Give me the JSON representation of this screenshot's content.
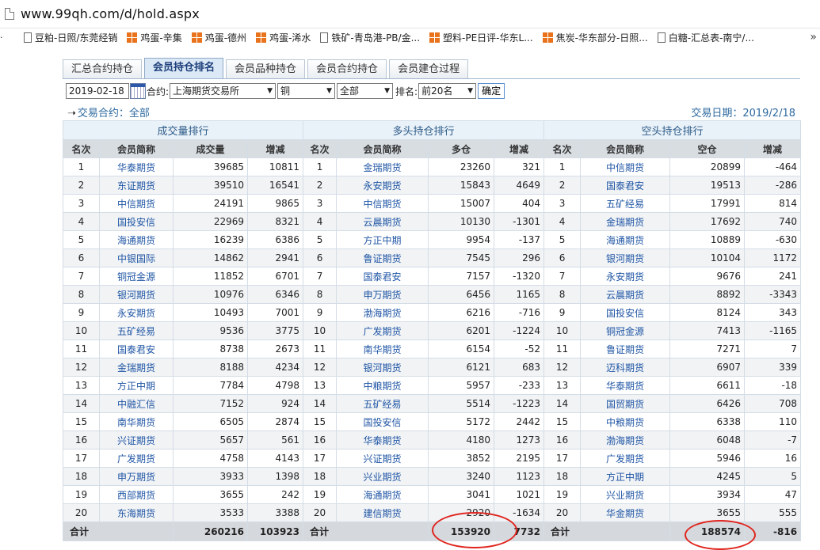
{
  "browser": {
    "url": "www.99qh.com/d/hold.aspx",
    "bookmarks": [
      {
        "icon": "doc",
        "label": "豆粕-日照/东莞经销"
      },
      {
        "icon": "grid",
        "label": "鸡蛋-辛集"
      },
      {
        "icon": "grid",
        "label": "鸡蛋-德州"
      },
      {
        "icon": "grid",
        "label": "鸡蛋-浠水"
      },
      {
        "icon": "doc",
        "label": "铁矿-青岛港-PB/金..."
      },
      {
        "icon": "doc",
        "label": "塑料-PE日评-华东L..."
      },
      {
        "icon": "grid",
        "label": "焦炭-华东部分-日照..."
      },
      {
        "icon": "doc",
        "label": "白糖-汇总表-南宁/..."
      }
    ]
  },
  "tabs": [
    "汇总合约持仓",
    "会员持仓排名",
    "会员品种持仓",
    "会员合约持仓",
    "会员建仓过程"
  ],
  "active_tab": 1,
  "filters": {
    "date": "2019-02-18",
    "contract_label": "合约:",
    "exchange": "上海期货交易所",
    "variety": "铜",
    "contract": "全部",
    "rank_label": "排名:",
    "rank": "前20名",
    "confirm": "确定"
  },
  "info": {
    "contract_text": "交易合约：全部",
    "date_text": "交易日期：2019/2/18"
  },
  "table": {
    "groups": [
      "成交量排行",
      "多头持仓排行",
      "空头持仓排行"
    ],
    "headers": [
      "名次",
      "会员简称",
      "成交量",
      "增减",
      "名次",
      "会员简称",
      "多仓",
      "增减",
      "名次",
      "会员简称",
      "空仓",
      "增减"
    ],
    "rows": [
      [
        "1",
        "华泰期货",
        "39685",
        "10811",
        "1",
        "金瑞期货",
        "23260",
        "321",
        "1",
        "中信期货",
        "20899",
        "-464"
      ],
      [
        "2",
        "东证期货",
        "39510",
        "16541",
        "2",
        "永安期货",
        "15843",
        "4649",
        "2",
        "国泰君安",
        "19513",
        "-286"
      ],
      [
        "3",
        "中信期货",
        "24191",
        "9865",
        "3",
        "中信期货",
        "15007",
        "404",
        "3",
        "五矿经易",
        "17991",
        "814"
      ],
      [
        "4",
        "国投安信",
        "22969",
        "8321",
        "4",
        "云晨期货",
        "10130",
        "-1301",
        "4",
        "金瑞期货",
        "17692",
        "740"
      ],
      [
        "5",
        "海通期货",
        "16239",
        "6386",
        "5",
        "方正中期",
        "9954",
        "-137",
        "5",
        "海通期货",
        "10889",
        "-630"
      ],
      [
        "6",
        "中银国际",
        "14862",
        "2941",
        "6",
        "鲁证期货",
        "7545",
        "296",
        "6",
        "银河期货",
        "10104",
        "1172"
      ],
      [
        "7",
        "铜冠金源",
        "11852",
        "6701",
        "7",
        "国泰君安",
        "7157",
        "-1320",
        "7",
        "永安期货",
        "9676",
        "241"
      ],
      [
        "8",
        "银河期货",
        "10976",
        "6346",
        "8",
        "申万期货",
        "6456",
        "1165",
        "8",
        "云晨期货",
        "8892",
        "-3343"
      ],
      [
        "9",
        "永安期货",
        "10493",
        "7001",
        "9",
        "渤海期货",
        "6216",
        "-716",
        "9",
        "国投安信",
        "8124",
        "343"
      ],
      [
        "10",
        "五矿经易",
        "9536",
        "3775",
        "10",
        "广发期货",
        "6201",
        "-1224",
        "10",
        "铜冠金源",
        "7413",
        "-1165"
      ],
      [
        "11",
        "国泰君安",
        "8738",
        "2673",
        "11",
        "南华期货",
        "6154",
        "-52",
        "11",
        "鲁证期货",
        "7271",
        "7"
      ],
      [
        "12",
        "金瑞期货",
        "8188",
        "4234",
        "12",
        "银河期货",
        "6121",
        "683",
        "12",
        "迈科期货",
        "6907",
        "339"
      ],
      [
        "13",
        "方正中期",
        "7784",
        "4798",
        "13",
        "中粮期货",
        "5957",
        "-233",
        "13",
        "华泰期货",
        "6611",
        "-18"
      ],
      [
        "14",
        "中融汇信",
        "7152",
        "924",
        "14",
        "五矿经易",
        "5514",
        "-1223",
        "14",
        "国贸期货",
        "6426",
        "708"
      ],
      [
        "15",
        "南华期货",
        "6505",
        "2874",
        "15",
        "国投安信",
        "5172",
        "2442",
        "15",
        "中粮期货",
        "6338",
        "110"
      ],
      [
        "16",
        "兴证期货",
        "5657",
        "561",
        "16",
        "华泰期货",
        "4180",
        "1273",
        "16",
        "渤海期货",
        "6048",
        "-7"
      ],
      [
        "17",
        "广发期货",
        "4758",
        "4143",
        "17",
        "兴证期货",
        "3852",
        "2195",
        "17",
        "广发期货",
        "5946",
        "16"
      ],
      [
        "18",
        "申万期货",
        "3933",
        "1398",
        "18",
        "兴业期货",
        "3240",
        "1123",
        "18",
        "方正中期",
        "4245",
        "5"
      ],
      [
        "19",
        "西部期货",
        "3655",
        "242",
        "19",
        "海通期货",
        "3041",
        "1021",
        "19",
        "兴业期货",
        "3934",
        "47"
      ],
      [
        "20",
        "东海期货",
        "3533",
        "3388",
        "20",
        "建信期货",
        "2920",
        "-1634",
        "20",
        "华金期货",
        "3655",
        "555"
      ]
    ],
    "total": {
      "label": "合计",
      "volume": "260216",
      "volume_change": "103923",
      "long": "153920",
      "long_change": "7732",
      "short": "188574",
      "short_change": "-816"
    }
  },
  "annotation_color": "#e0241d"
}
